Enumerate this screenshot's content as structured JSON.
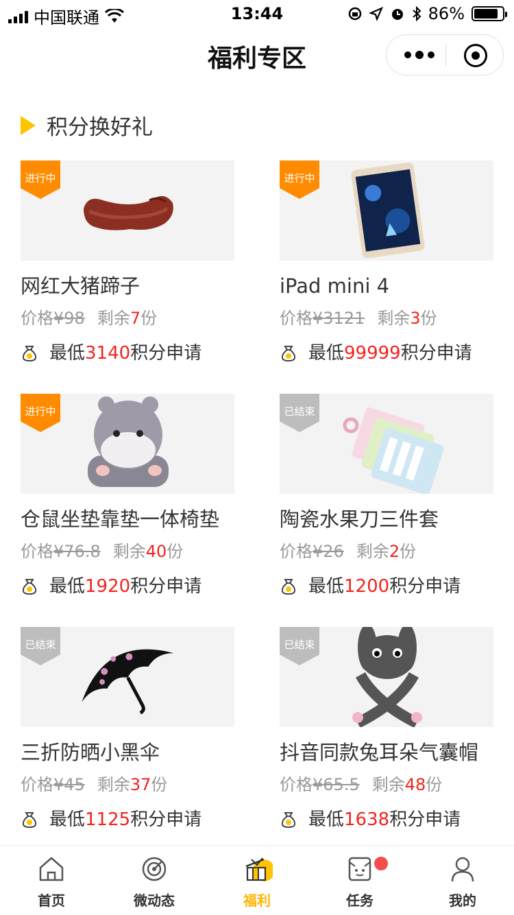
{
  "status_bar": {
    "carrier": "中国联通",
    "time": "13:44",
    "battery": "86%",
    "battery_level": 0.86,
    "icons": [
      "signal-icon",
      "wifi-icon",
      "rotation-lock-icon",
      "location-icon",
      "alarm-icon",
      "bluetooth-icon",
      "battery-icon"
    ]
  },
  "nav": {
    "title": "福利专区",
    "capsule_icons": [
      "more-icon",
      "close-target-icon"
    ]
  },
  "section": {
    "title": "积分换好礼",
    "icon": "triangle-icon"
  },
  "labels": {
    "price": "价格",
    "currency": "¥",
    "remaining": "剩余",
    "unit": "份",
    "lowest": "最低",
    "points_apply": "积分申请"
  },
  "products": [
    {
      "badge": "进行中",
      "status": "active",
      "image": "pig-trotter-image",
      "title": "网红大猪蹄子",
      "price": "98",
      "remaining": "7",
      "points": "3140"
    },
    {
      "badge": "进行中",
      "status": "active",
      "image": "ipad-image",
      "title": "iPad mini 4",
      "price": "3121",
      "remaining": "3",
      "points": "99999"
    },
    {
      "badge": "进行中",
      "status": "active",
      "image": "hamster-cushion-image",
      "title": "仓鼠坐垫靠垫一体椅垫",
      "price": "76.8",
      "remaining": "40",
      "points": "1920"
    },
    {
      "badge": "已结束",
      "status": "ended",
      "image": "ceramic-knife-set-image",
      "title": "陶瓷水果刀三件套",
      "price": "26",
      "remaining": "2",
      "points": "1200"
    },
    {
      "badge": "已结束",
      "status": "ended",
      "image": "umbrella-image",
      "title": "三折防晒小黑伞",
      "price": "45",
      "remaining": "37",
      "points": "1125"
    },
    {
      "badge": "已结束",
      "status": "ended",
      "image": "rabbit-ear-hat-image",
      "title": "抖音同款兔耳朵气囊帽",
      "price": "65.5",
      "remaining": "48",
      "points": "1638"
    }
  ],
  "tabs": [
    {
      "label": "首页",
      "icon": "home-icon",
      "active": false
    },
    {
      "label": "微动态",
      "icon": "radar-icon",
      "active": false
    },
    {
      "label": "福利",
      "icon": "gift-icon",
      "active": true
    },
    {
      "label": "任务",
      "icon": "task-icon",
      "active": false,
      "has_dot": true
    },
    {
      "label": "我的",
      "icon": "user-icon",
      "active": false
    }
  ],
  "colors": {
    "accent": "#ffb400",
    "badge_active": "#ff8c00",
    "badge_ended": "#bdbdbd",
    "highlight_red": "#f4221e"
  }
}
